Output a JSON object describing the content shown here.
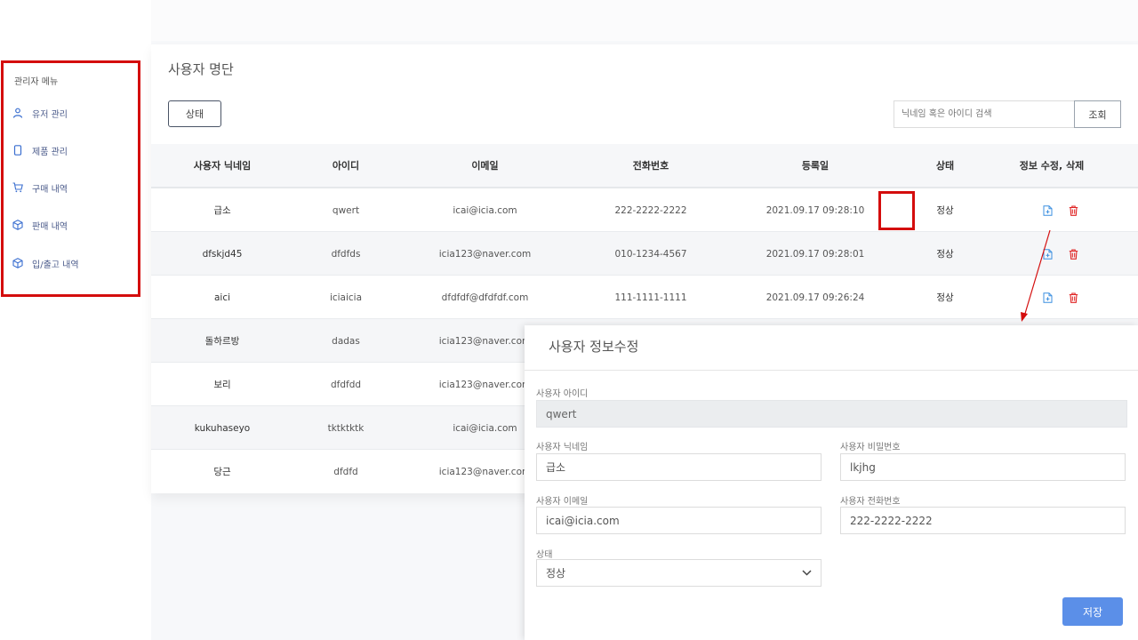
{
  "sidebar": {
    "title": "관리자 메뉴",
    "items": [
      {
        "label": "유저 관리",
        "icon": "user-icon"
      },
      {
        "label": "제품 관리",
        "icon": "mobile-icon"
      },
      {
        "label": "구매 내역",
        "icon": "cart-icon"
      },
      {
        "label": "판매 내역",
        "icon": "box-icon"
      },
      {
        "label": "입/출고 내역",
        "icon": "box-icon"
      }
    ]
  },
  "main": {
    "title": "사용자 명단",
    "status_button": "상태",
    "search": {
      "placeholder": "닉네임 혹은 아이디 검색",
      "button": "조회"
    }
  },
  "table": {
    "headers": [
      "사용자 닉네임",
      "아이디",
      "이메일",
      "전화번호",
      "등록일",
      "상태",
      "정보 수정, 삭제"
    ],
    "rows": [
      {
        "nickname": "급소",
        "id": "qwert",
        "email": "icai@icia.com",
        "phone": "222-2222-2222",
        "date": "2021.09.17 09:28:10",
        "status": "정상"
      },
      {
        "nickname": "dfskjd45",
        "id": "dfdfds",
        "email": "icia123@naver.com",
        "phone": "010-1234-4567",
        "date": "2021.09.17 09:28:01",
        "status": "정상"
      },
      {
        "nickname": "aici",
        "id": "iciaicia",
        "email": "dfdfdf@dfdfdf.com",
        "phone": "111-1111-1111",
        "date": "2021.09.17 09:26:24",
        "status": "정상"
      },
      {
        "nickname": "돌하르방",
        "id": "dadas",
        "email": "icia123@naver.com"
      },
      {
        "nickname": "보리",
        "id": "dfdfdd",
        "email": "icia123@naver.com"
      },
      {
        "nickname": "kukuhaseyo",
        "id": "tktktktk",
        "email": "icai@icia.com"
      },
      {
        "nickname": "당근",
        "id": "dfdfd",
        "email": "icia123@naver.com"
      }
    ]
  },
  "modal": {
    "title": "사용자 정보수정",
    "fields": {
      "user_id_label": "사용자 아이디",
      "user_id_value": "qwert",
      "nickname_label": "사용자 닉네임",
      "nickname_value": "급소",
      "password_label": "사용자 비밀번호",
      "password_value": "lkjhg",
      "email_label": "사용자 이메일",
      "email_value": "icai@icia.com",
      "phone_label": "사용자 전화번호",
      "phone_value": "222-2222-2222",
      "status_label": "상태",
      "status_value": "정상"
    },
    "save_button": "저장"
  },
  "colors": {
    "highlight": "#d40d0d",
    "primary": "#5b8fe8",
    "edit_icon": "#3b8fe0",
    "delete_icon": "#e02424",
    "menu_text": "#4a5a8a"
  }
}
